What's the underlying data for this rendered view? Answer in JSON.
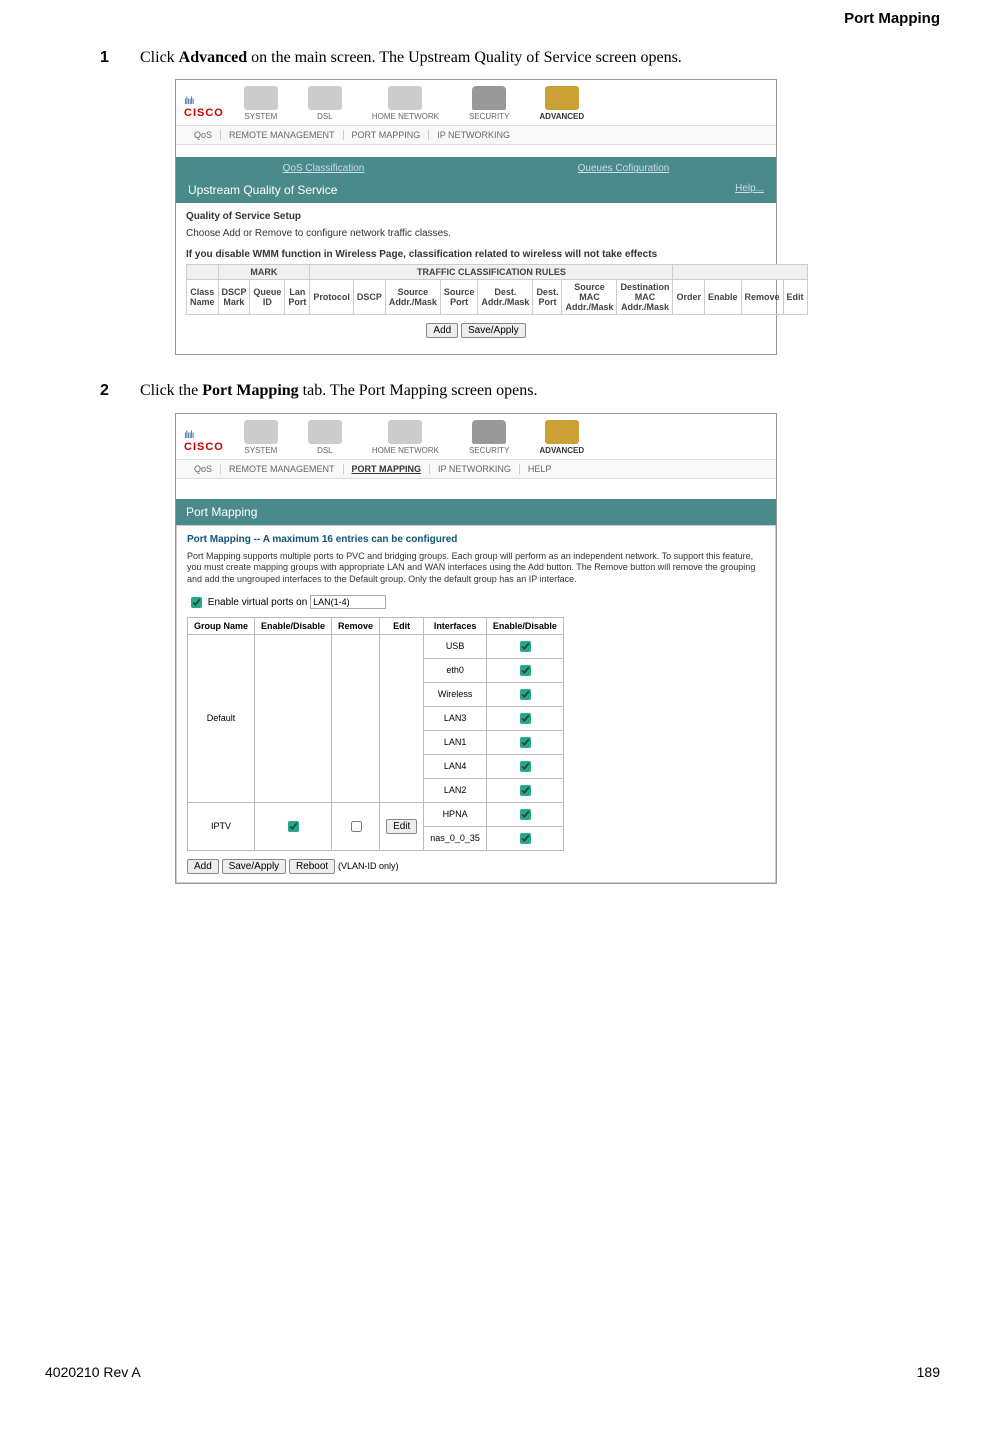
{
  "header": {
    "section_title": "Port Mapping"
  },
  "steps": [
    {
      "num": "1",
      "text_pre": "Click ",
      "bold": "Advanced",
      "text_post": " on the main screen. The Upstream Quality of Service screen opens."
    },
    {
      "num": "2",
      "text_pre": "Click the ",
      "bold": "Port Mapping",
      "text_post": " tab. The Port Mapping screen opens."
    }
  ],
  "footer": {
    "left": "4020210 Rev A",
    "right": "189"
  },
  "screenshot1": {
    "logo_bars": "ılıılı",
    "logo_text": "CISCO",
    "main_tabs": [
      "SYSTEM",
      "DSL",
      "HOME NETWORK",
      "SECURITY",
      "ADVANCED"
    ],
    "sub_tabs": [
      "QoS",
      "REMOTE MANAGEMENT",
      "PORT MAPPING",
      "IP NETWORKING"
    ],
    "panel_tabs": [
      "QoS Classification",
      "Queues Cofiguration"
    ],
    "panel_title": "Upstream Quality of Service",
    "help": "Help...",
    "setup_heading": "Quality of Service Setup",
    "setup_desc": "Choose Add or Remove to configure network traffic classes.",
    "wmm_note": "If you disable WMM function in Wireless Page, classification related to wireless will not take effects",
    "group_headers": [
      "MARK",
      "TRAFFIC CLASSIFICATION RULES"
    ],
    "columns": [
      "Class Name",
      "DSCP Mark",
      "Queue ID",
      "Lan Port",
      "Protocol",
      "DSCP",
      "Source Addr./Mask",
      "Source Port",
      "Dest. Addr./Mask",
      "Dest. Port",
      "Source MAC Addr./Mask",
      "Destination MAC Addr./Mask",
      "Order",
      "Enable",
      "Remove",
      "Edit"
    ],
    "buttons": [
      "Add",
      "Save/Apply"
    ]
  },
  "screenshot2": {
    "logo_bars": "ılıılı",
    "logo_text": "CISCO",
    "main_tabs": [
      "SYSTEM",
      "DSL",
      "HOME NETWORK",
      "SECURITY",
      "ADVANCED"
    ],
    "sub_tabs": [
      "QoS",
      "REMOTE MANAGEMENT",
      "PORT MAPPING",
      "IP NETWORKING",
      "HELP"
    ],
    "active_sub": "PORT MAPPING",
    "panel_title": "Port Mapping",
    "pm_heading": "Port Mapping -- A maximum 16 entries can be configured",
    "pm_desc": "Port Mapping supports multiple ports to PVC and bridging groups. Each group will perform as an independent network. To support this feature, you must create mapping groups with appropriate LAN and WAN interfaces using the Add button. The Remove button will remove the grouping and add the ungrouped interfaces to the Default group. Only the default group has an IP interface.",
    "enable_label": "Enable virtual ports on",
    "enable_value": "LAN(1-4)",
    "table_headers": [
      "Group Name",
      "Enable/Disable",
      "Remove",
      "Edit",
      "Interfaces",
      "Enable/Disable"
    ],
    "groups": [
      {
        "name": "Default",
        "enable": "",
        "remove": "",
        "edit": "",
        "interfaces": [
          {
            "name": "USB",
            "checked": true
          },
          {
            "name": "eth0",
            "checked": true
          },
          {
            "name": "Wireless",
            "checked": true
          },
          {
            "name": "LAN3",
            "checked": true
          },
          {
            "name": "LAN1",
            "checked": true
          },
          {
            "name": "LAN4",
            "checked": true
          },
          {
            "name": "LAN2",
            "checked": true
          }
        ]
      },
      {
        "name": "IPTV",
        "enable_checked": true,
        "remove_checked": false,
        "edit": "Edit",
        "interfaces": [
          {
            "name": "HPNA",
            "checked": true
          },
          {
            "name": "nas_0_0_35",
            "checked": true
          }
        ]
      }
    ],
    "bottom_buttons": [
      "Add",
      "Save/Apply",
      "Reboot"
    ],
    "bottom_note": "(VLAN-ID only)"
  }
}
